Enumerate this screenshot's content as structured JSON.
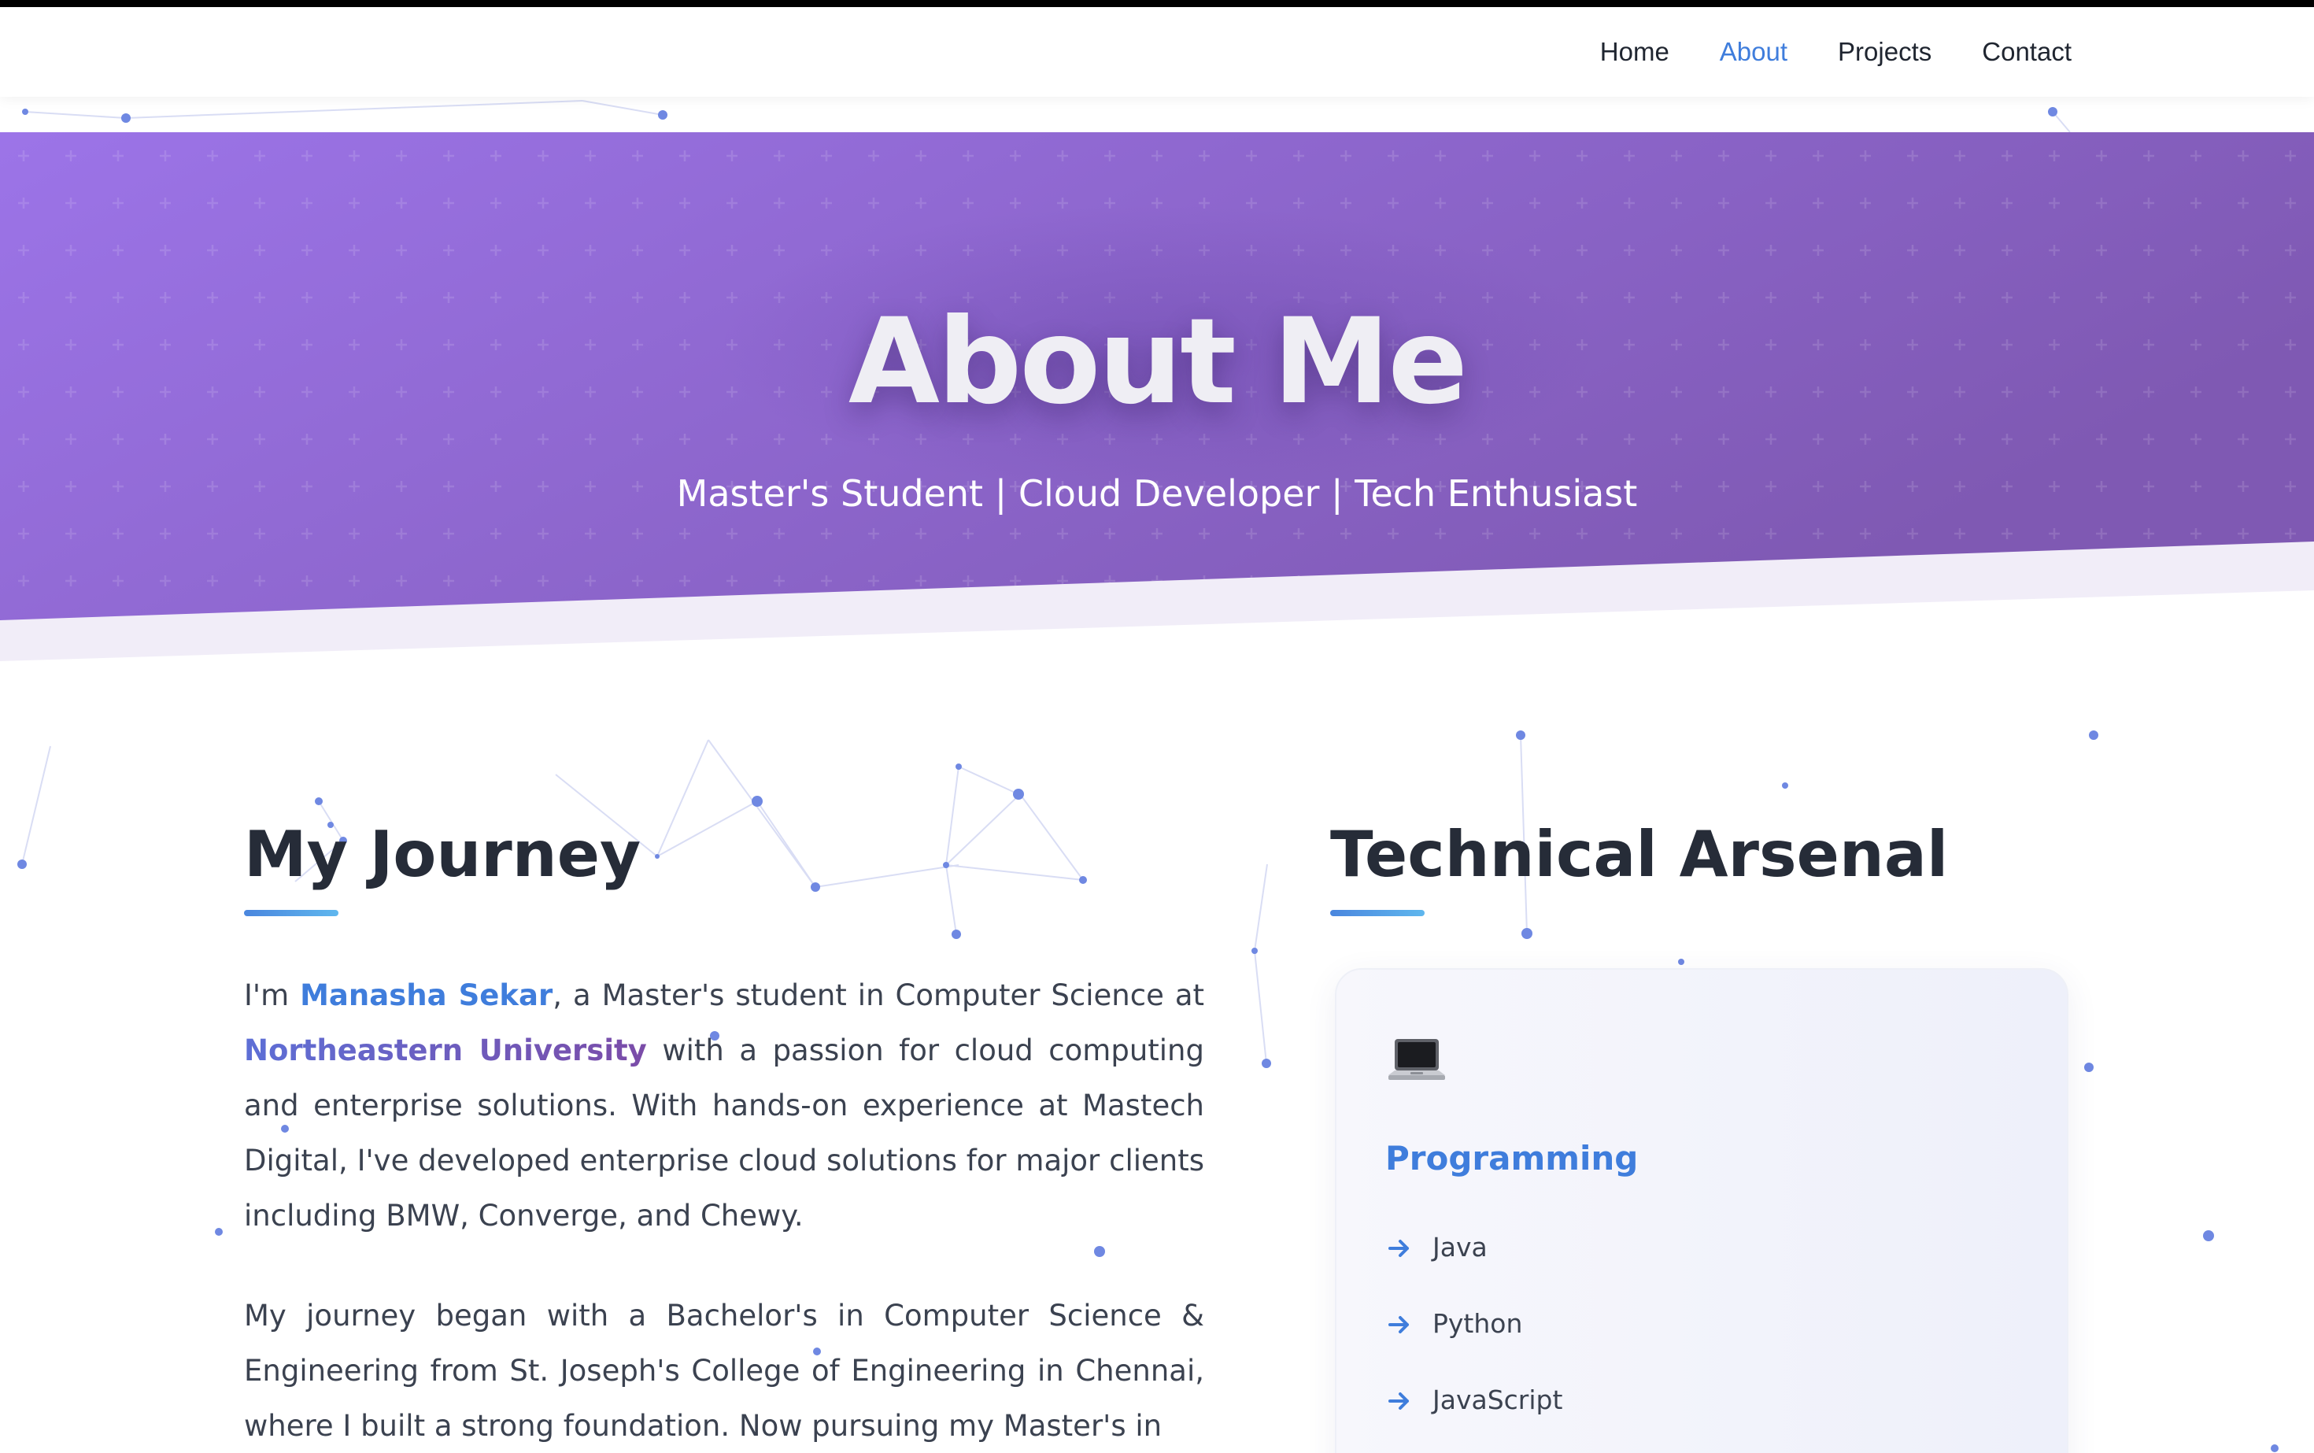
{
  "nav": {
    "items": [
      {
        "label": "Home"
      },
      {
        "label": "About"
      },
      {
        "label": "Projects"
      },
      {
        "label": "Contact"
      }
    ],
    "active": "About"
  },
  "hero": {
    "title": "About Me",
    "subtitle": "Master's Student | Cloud Developer | Tech Enthusiast",
    "gradient_start": "#9c74e8",
    "gradient_end": "#7f59b3"
  },
  "journey": {
    "title": "My Journey",
    "p1": {
      "pre": "I'm ",
      "name": "Manasha Sekar",
      "mid": ", a Master's student in Computer Science at ",
      "university": "Northeastern University",
      "post": " with a passion for cloud computing and enterprise solutions. With hands-on experience at Mastech Digital, I've developed enterprise cloud solutions for major clients including BMW, Converge, and Chewy."
    },
    "p2": "My journey began with a Bachelor's in Computer Science & Engineering from St. Joseph's College of Engineering in Chennai, where I built a strong foundation. Now pursuing my Master's in"
  },
  "arsenal": {
    "title": "Technical Arsenal",
    "card": {
      "icon": "laptop-icon",
      "title": "Programming",
      "skills": [
        "Java",
        "Python",
        "JavaScript"
      ]
    }
  },
  "colors": {
    "accent": "#3f7ddc",
    "heading": "#262c38",
    "body_text": "#3b4250"
  }
}
